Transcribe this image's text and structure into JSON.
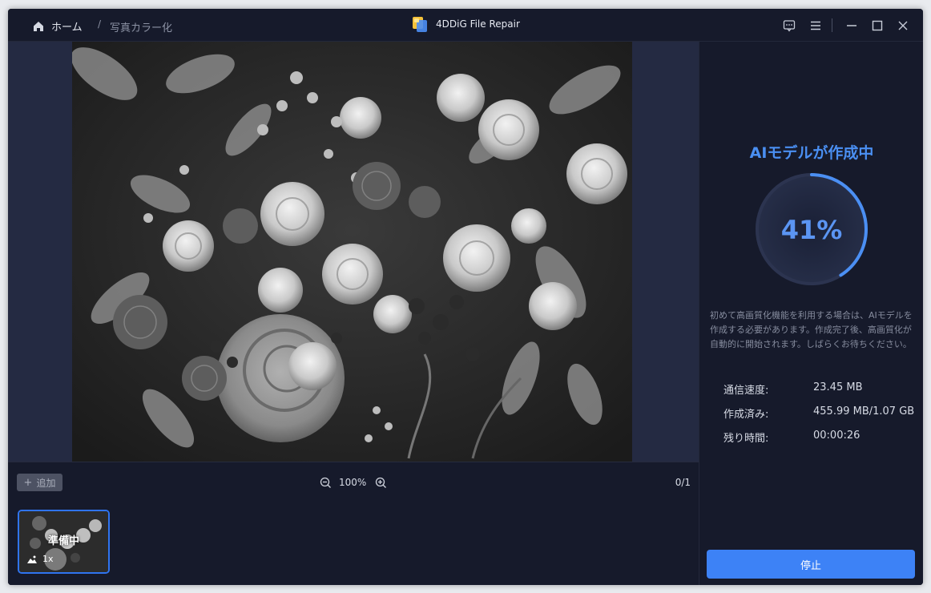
{
  "titlebar": {
    "home_label": "ホーム",
    "separator": "/",
    "current": "写真カラー化",
    "app_title": "4DDiG File Repair"
  },
  "toolbar": {
    "add_label": "追加",
    "zoom_level": "100%",
    "count": "0/1"
  },
  "thumbnail": {
    "status": "準備中",
    "scale": "1x"
  },
  "panel": {
    "title": "AIモデルが作成中",
    "progress_text": "41%",
    "progress": 0.41,
    "note": "初めて高画質化機能を利用する場合は、AIモデルを作成する必要があります。作成完了後、高画質化が自動的に開始されます。しばらくお待ちください。",
    "stats": [
      {
        "label": "通信速度:",
        "value": "23.45 MB"
      },
      {
        "label": "作成済み:",
        "value": "455.99 MB/1.07 GB"
      },
      {
        "label": "残り時間:",
        "value": "00:00:26"
      }
    ],
    "stop_label": "停止"
  },
  "colors": {
    "accent": "#3d82f6",
    "title_blue": "#4a8ff2",
    "background": "#161a2b"
  }
}
